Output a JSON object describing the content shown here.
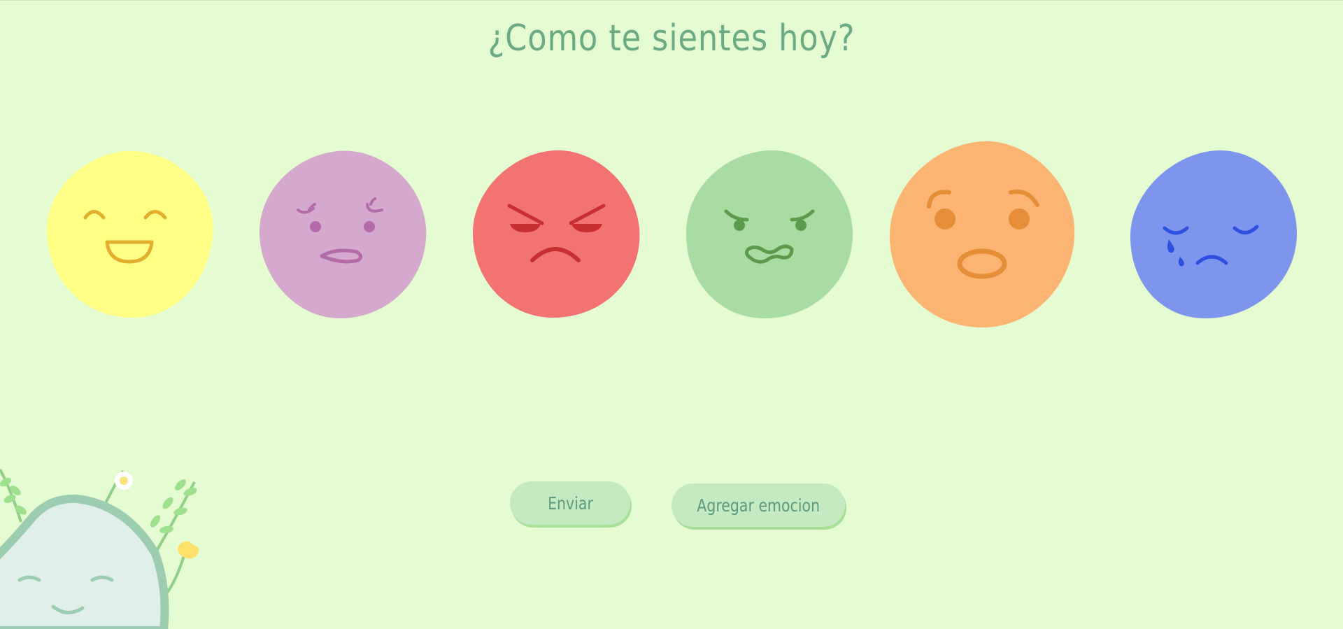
{
  "header": {
    "title": "¿Como te sientes hoy?"
  },
  "emotions": [
    {
      "name": "feliz",
      "color": "#ffff85",
      "feature_color": "#e2ae2c"
    },
    {
      "name": "preocupado",
      "color": "#d4a9cd",
      "feature_color": "#b36aa9"
    },
    {
      "name": "enojado",
      "color": "#f37373",
      "feature_color": "#c72f31"
    },
    {
      "name": "asqueado",
      "color": "#a8dca2",
      "feature_color": "#5b9b4b"
    },
    {
      "name": "sorprendido",
      "color": "#fbb471",
      "feature_color": "#e58e37"
    },
    {
      "name": "triste",
      "color": "#7e95ed",
      "feature_color": "#2f4fe0"
    }
  ],
  "actions": {
    "send_label": "Enviar",
    "add_label": "Agregar emocion"
  },
  "colors": {
    "background": "#e5fcd2",
    "title": "#6aab84",
    "button_bg": "#c5e9c0",
    "button_shadow": "#a8e09a",
    "button_text": "#5d9a7e",
    "mascot_body": "#e0efea",
    "mascot_outline": "#9ccdb0"
  }
}
